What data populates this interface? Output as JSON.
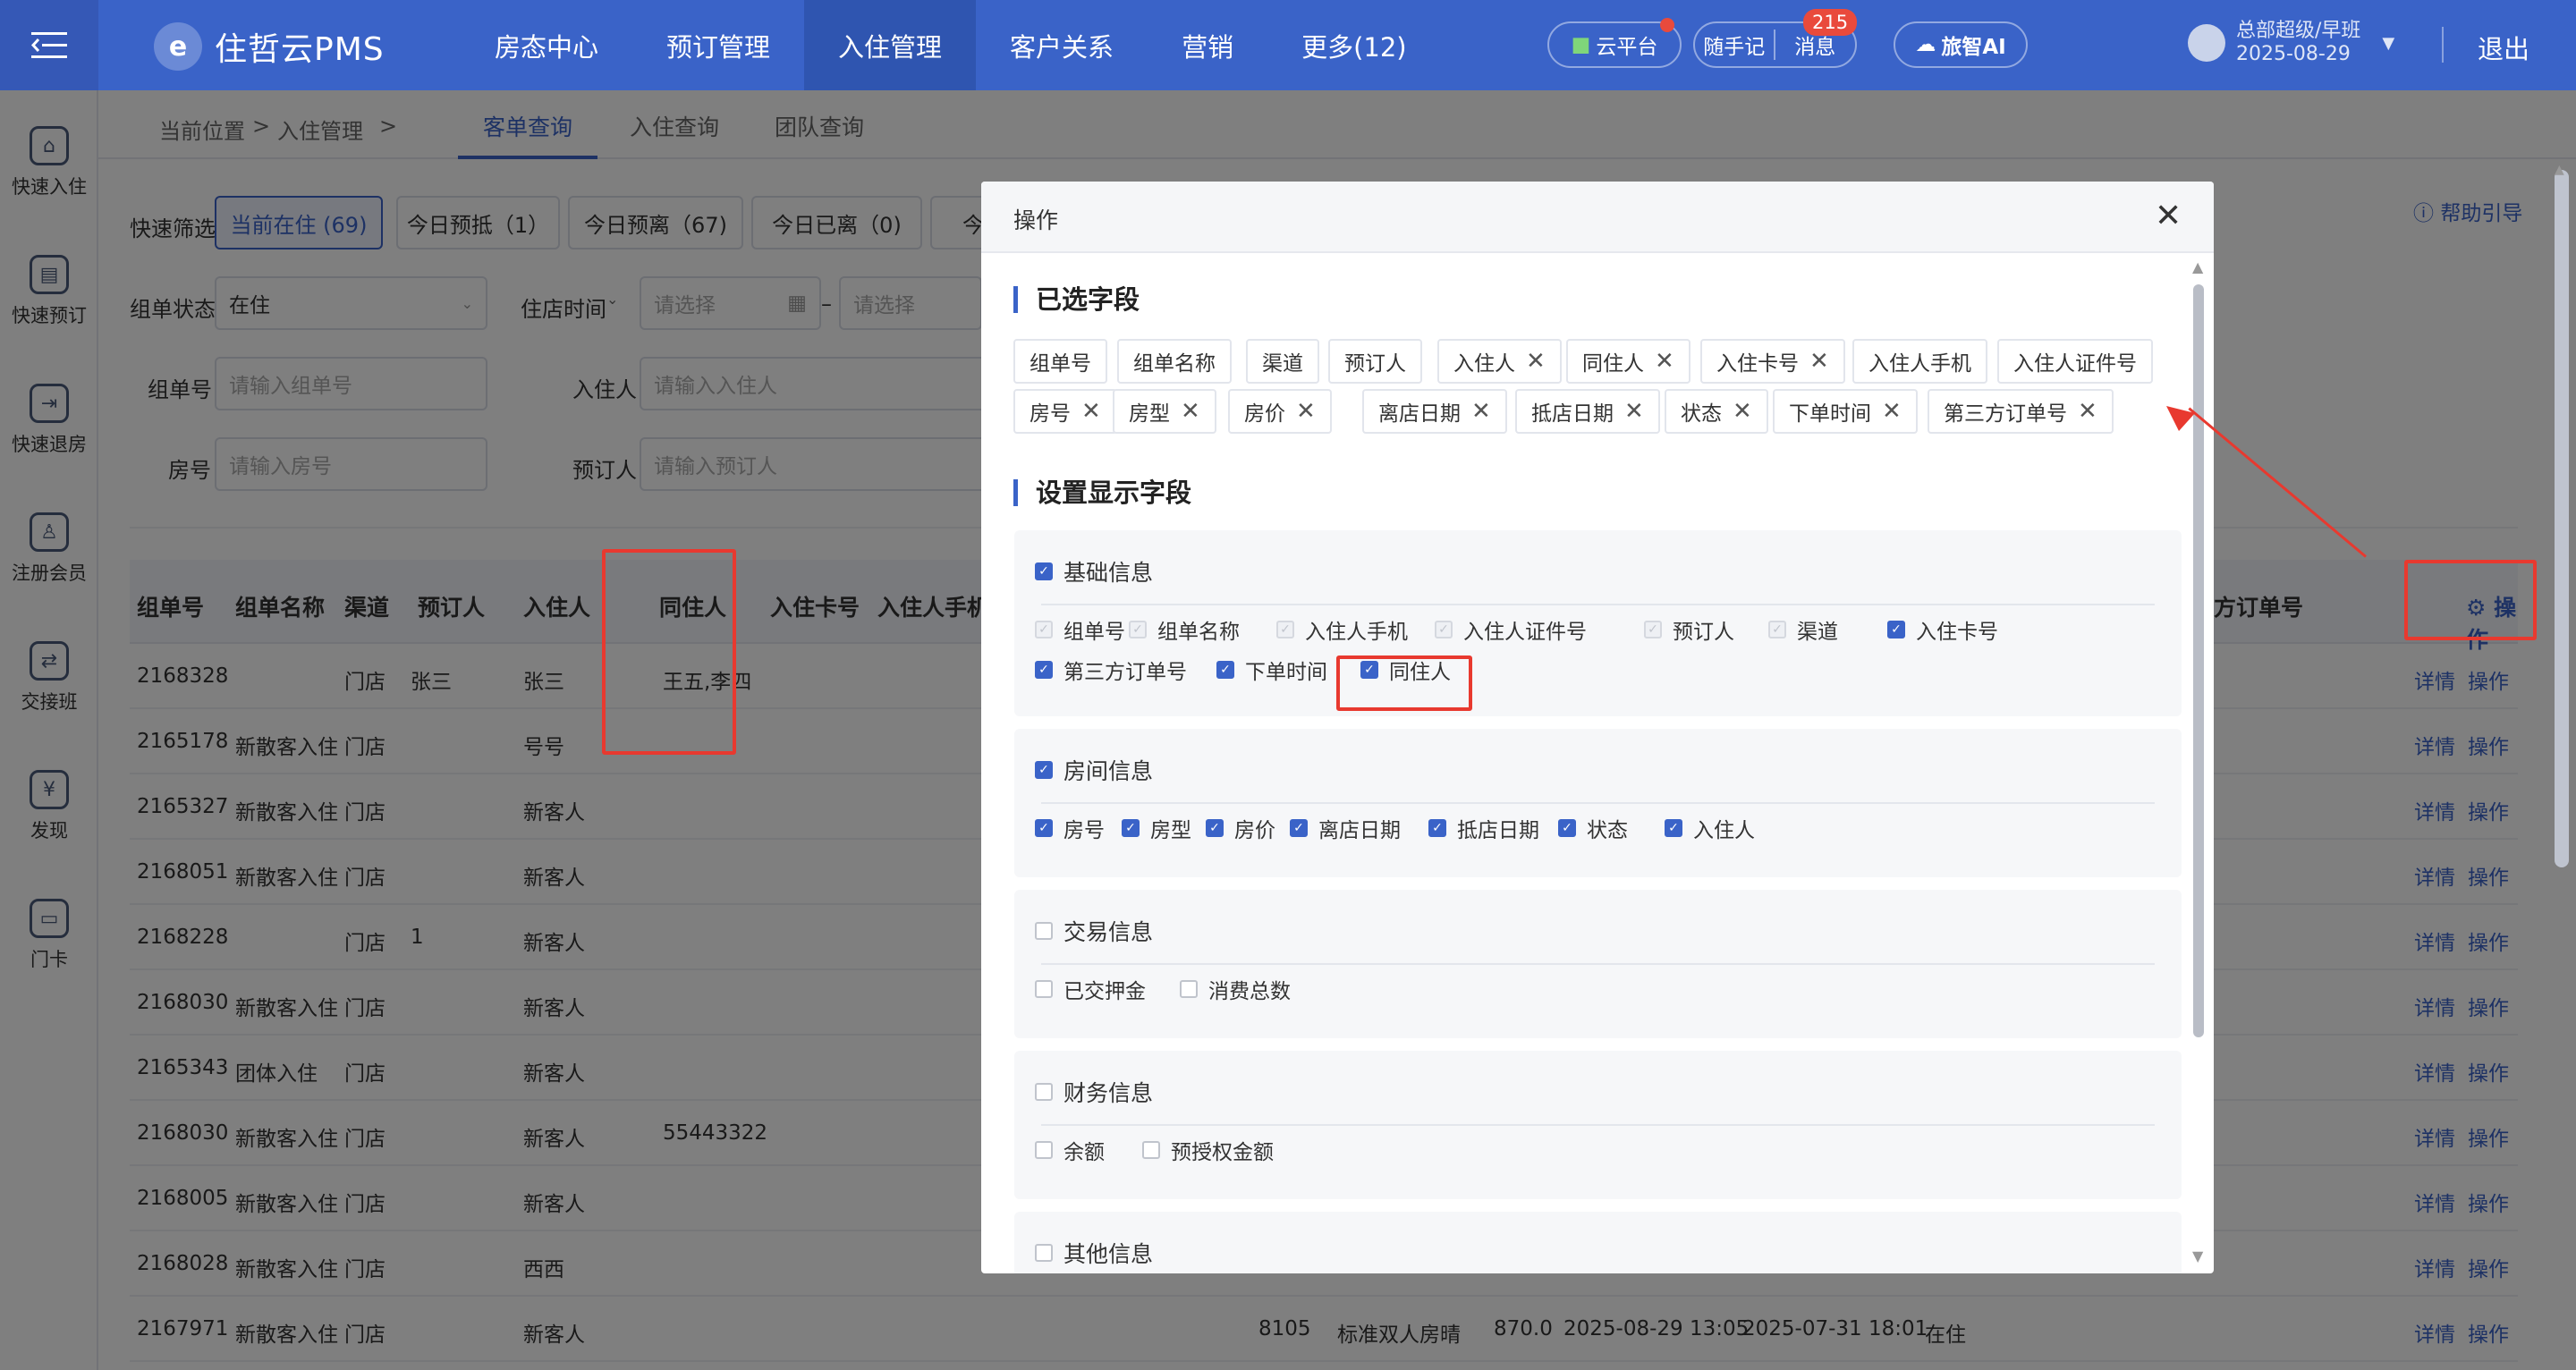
{
  "header": {
    "logo_text": "住哲云PMS",
    "nav": [
      "房态中心",
      "预订管理",
      "入住管理",
      "客户关系",
      "营销",
      "更多(12)"
    ],
    "active_nav_index": 2,
    "cloud_label": "云平台",
    "notes_label": "随手记",
    "messages_label": "消息",
    "messages_count": "215",
    "ai_label": "旅智AI",
    "user_role": "总部超级/早班",
    "user_date": "2025-08-29",
    "logout_label": "退出"
  },
  "sidebar": [
    "快速入住",
    "快速预订",
    "快速退房",
    "注册会员",
    "交接班",
    "发现",
    "门卡"
  ],
  "breadcrumb": {
    "label": "当前位置",
    "sep": ">",
    "item": "入住管理"
  },
  "tabs": [
    "客单查询",
    "入住查询",
    "团队查询"
  ],
  "help_label": "帮助引导",
  "quick_filter": {
    "label": "快速筛选",
    "buttons": [
      "当前在住 (69)",
      "今日预抵（1）",
      "今日预离（67)",
      "今日已离（0)",
      "今日"
    ]
  },
  "filters": {
    "group_status_label": "组单状态",
    "group_status_value": "在住",
    "stay_time_label": "住店时间",
    "date_placeholder": "请选择",
    "date_sep": "–",
    "group_no_label": "组单号",
    "group_no_placeholder": "请输入组单号",
    "guest_label": "入住人",
    "guest_placeholder": "请输入入住人",
    "room_label": "房号",
    "room_placeholder": "请输入房号",
    "booker_label": "预订人",
    "booker_placeholder": "请输入预订人"
  },
  "table": {
    "headers": [
      "组单号",
      "组单名称",
      "渠道",
      "预订人",
      "入住人",
      "同住人",
      "入住卡号",
      "入住人手机"
    ],
    "right_header": "方订单号",
    "op_header": "操作",
    "detail_label": "详情",
    "op_label": "操作",
    "rows": [
      [
        "2168328",
        "",
        "门店",
        "张三",
        "张三",
        "王五,李四"
      ],
      [
        "2165178",
        "新散客入住",
        "门店",
        "",
        "号号",
        ""
      ],
      [
        "2165327",
        "新散客入住",
        "门店",
        "",
        "新客人",
        ""
      ],
      [
        "2168051",
        "新散客入住",
        "门店",
        "",
        "新客人",
        ""
      ],
      [
        "2168228",
        "",
        "门店",
        "1",
        "新客人",
        ""
      ],
      [
        "2168030",
        "新散客入住",
        "门店",
        "",
        "新客人",
        ""
      ],
      [
        "2165343",
        "团体入住",
        "门店",
        "",
        "新客人",
        ""
      ],
      [
        "2168030",
        "新散客入住",
        "门店",
        "",
        "新客人",
        "55443322"
      ],
      [
        "2168005",
        "新散客入住",
        "门店",
        "",
        "新客人",
        ""
      ],
      [
        "2168028",
        "新散客入住",
        "门店",
        "",
        "西西",
        ""
      ],
      [
        "2167971",
        "新散客入住",
        "门店",
        "",
        "新客人",
        ""
      ]
    ],
    "last_row_extra": [
      "8105",
      "标准双人房晴",
      "870.0",
      "2025-08-29 13:05",
      "2025-07-31 18:01",
      "在住"
    ]
  },
  "modal": {
    "title": "操作",
    "selected_title": "已选字段",
    "selected_chips": [
      {
        "label": "组单号",
        "removable": false
      },
      {
        "label": "组单名称",
        "removable": false
      },
      {
        "label": "渠道",
        "removable": false
      },
      {
        "label": "预订人",
        "removable": false
      },
      {
        "label": "入住人",
        "removable": true
      },
      {
        "label": "同住人",
        "removable": true
      },
      {
        "label": "入住卡号",
        "removable": true
      },
      {
        "label": "入住人手机",
        "removable": false
      },
      {
        "label": "入住人证件号",
        "removable": false
      },
      {
        "label": "房号",
        "removable": true
      },
      {
        "label": "房型",
        "removable": true
      },
      {
        "label": "房价",
        "removable": true
      },
      {
        "label": "离店日期",
        "removable": true
      },
      {
        "label": "抵店日期",
        "removable": true
      },
      {
        "label": "状态",
        "removable": true
      },
      {
        "label": "下单时间",
        "removable": true
      },
      {
        "label": "第三方订单号",
        "removable": true
      }
    ],
    "settings_title": "设置显示字段",
    "groups": [
      {
        "title": "基础信息",
        "checked": true,
        "items": [
          {
            "label": "组单号",
            "state": "disabled"
          },
          {
            "label": "组单名称",
            "state": "disabled"
          },
          {
            "label": "入住人手机",
            "state": "disabled"
          },
          {
            "label": "入住人证件号",
            "state": "disabled"
          },
          {
            "label": "预订人",
            "state": "disabled"
          },
          {
            "label": "渠道",
            "state": "disabled"
          },
          {
            "label": "入住卡号",
            "state": "checked"
          },
          {
            "label": "第三方订单号",
            "state": "checked"
          },
          {
            "label": "下单时间",
            "state": "checked"
          },
          {
            "label": "同住人",
            "state": "checked"
          }
        ]
      },
      {
        "title": "房间信息",
        "checked": true,
        "items": [
          {
            "label": "房号",
            "state": "checked"
          },
          {
            "label": "房型",
            "state": "checked"
          },
          {
            "label": "房价",
            "state": "checked"
          },
          {
            "label": "离店日期",
            "state": "checked"
          },
          {
            "label": "抵店日期",
            "state": "checked"
          },
          {
            "label": "状态",
            "state": "checked"
          },
          {
            "label": "入住人",
            "state": "checked"
          }
        ]
      },
      {
        "title": "交易信息",
        "checked": false,
        "items": [
          {
            "label": "已交押金",
            "state": "unchecked"
          },
          {
            "label": "消费总数",
            "state": "unchecked"
          }
        ]
      },
      {
        "title": "财务信息",
        "checked": false,
        "items": [
          {
            "label": "余额",
            "state": "unchecked"
          },
          {
            "label": "预授权金额",
            "state": "unchecked"
          }
        ]
      },
      {
        "title": "其他信息",
        "checked": false,
        "items": []
      }
    ]
  },
  "colors": {
    "primary": "#3a63c8",
    "annotation": "#e8392f"
  }
}
